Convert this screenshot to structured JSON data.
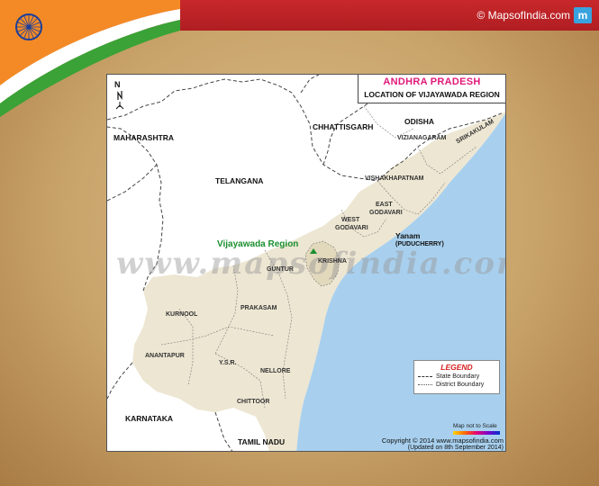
{
  "header": {
    "brand_text": "© MapsofIndia.com",
    "brand_icon": "m"
  },
  "map": {
    "title": "ANDHRA PRADESH",
    "subtitle": "LOCATION OF VIJAYAWADA REGION",
    "north": "N",
    "states": {
      "maharashtra": "MAHARASHTRA",
      "chhattisgarh": "CHHATTISGARH",
      "odisha": "ODISHA",
      "telangana": "TELANGANA",
      "karnataka": "KARNATAKA",
      "tamil_nadu": "TAMIL NADU"
    },
    "districts": {
      "vizianagaram": "VIZIANAGARAM",
      "srikakulam": "SRIKAKULAM",
      "vishakhapatnam": "VISHAKHAPATNAM",
      "east_godavari_1": "EAST",
      "east_godavari_2": "GODAVARI",
      "west_godavari_1": "WEST",
      "west_godavari_2": "GODAVARI",
      "krishna": "KRISHNA",
      "guntur": "GUNTUR",
      "kurnool": "KURNOOL",
      "prakasam": "PRAKASAM",
      "anantapur": "ANANTAPUR",
      "ysr": "Y.S.R.",
      "nellore": "NELLORE",
      "chittoor": "CHITTOOR"
    },
    "highlight": "Vijayawada Region",
    "yanam": "Yanam",
    "puducherry": "(PUDUCHERRY)",
    "watermark": "www.mapsofindia.com",
    "legend": {
      "title": "LEGEND",
      "state_boundary": "State Boundary",
      "district_boundary": "District Boundary"
    },
    "scale_note": "Map not to Scale",
    "copyright": "Copyright © 2014 www.mapsofindia.com",
    "updated": "(Updated on 8th September 2014)",
    "colors": {
      "land_ap": "#ede6d2",
      "sea": "#a8d0ee",
      "highlight": "#1a8f2f",
      "title": "#e0197a"
    }
  }
}
